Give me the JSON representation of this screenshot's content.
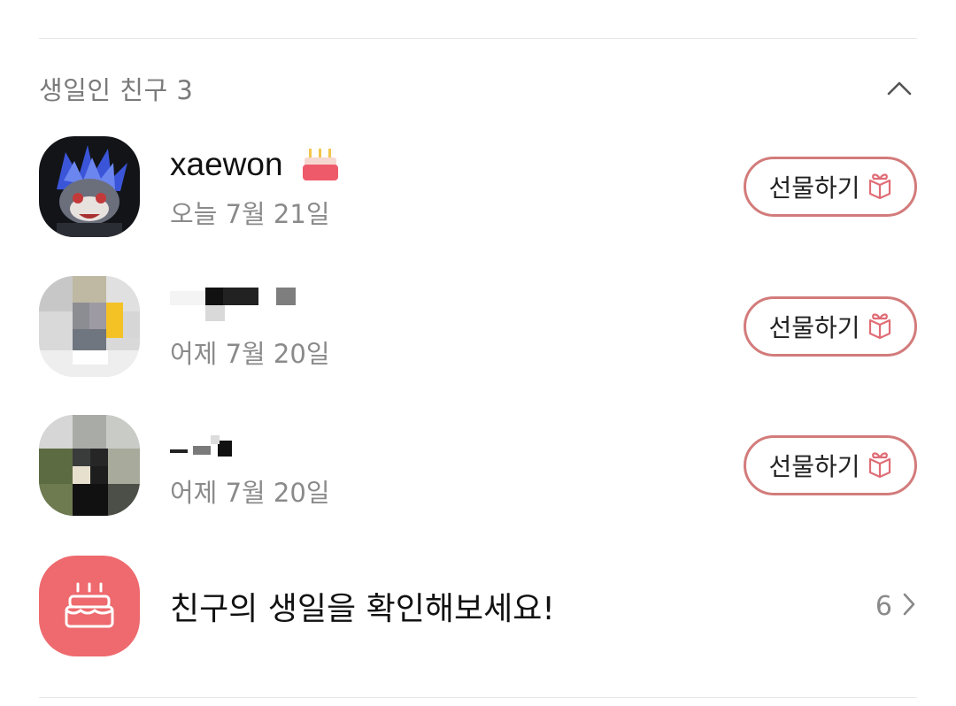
{
  "section": {
    "title": "생일인 친구 3",
    "collapse_icon": "chevron-up-icon"
  },
  "friends": [
    {
      "name": "xaewon",
      "badge_icon": "birthday-cake-icon",
      "date": "오늘 7월 21일",
      "gift_label": "선물하기",
      "gift_icon": "gift-icon"
    },
    {
      "name": "",
      "date": "어제 7월 20일",
      "gift_label": "선물하기",
      "gift_icon": "gift-icon"
    },
    {
      "name": "",
      "date": "어제 7월 20일",
      "gift_label": "선물하기",
      "gift_icon": "gift-icon"
    }
  ],
  "promo": {
    "icon": "cake-icon",
    "text": "친구의 생일을 확인해보세요!",
    "count": "6",
    "chevron_icon": "chevron-right-icon"
  },
  "colors": {
    "accent": "#ee6a6e",
    "gift_border": "#d37b7b",
    "muted_text": "#8a8a8a"
  }
}
